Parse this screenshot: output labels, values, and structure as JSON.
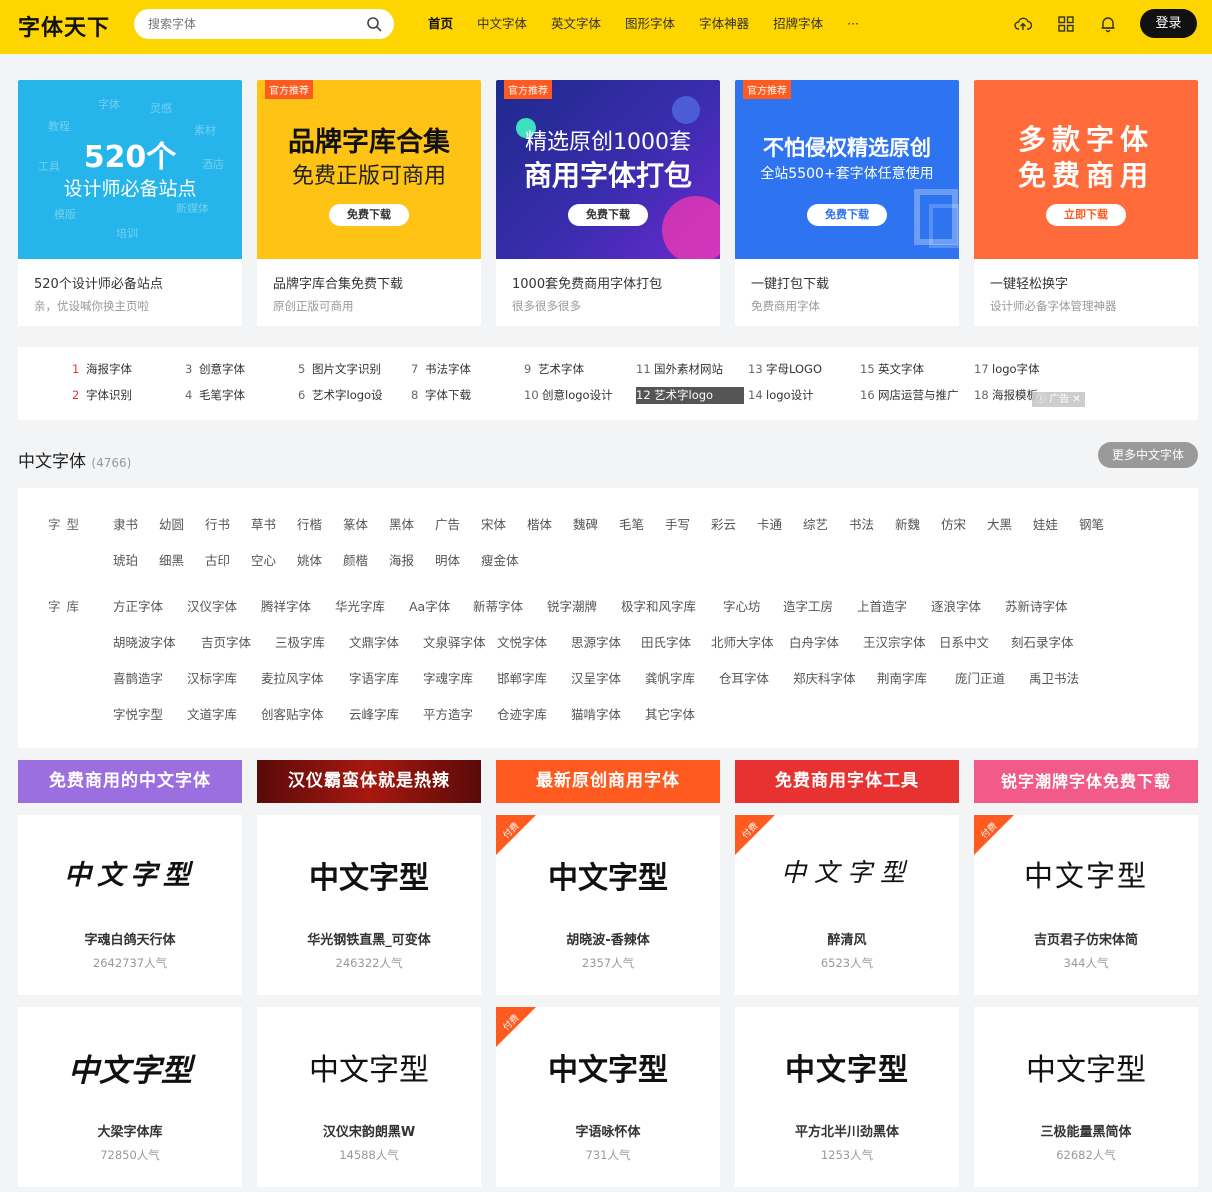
{
  "header": {
    "logo": "字体天下",
    "search_placeholder": "搜索字体",
    "nav": [
      "首页",
      "中文字体",
      "英文字体",
      "图形字体",
      "字体神器",
      "招牌字体",
      "···"
    ],
    "login": "登录"
  },
  "banners": [
    {
      "big": "520个",
      "sub": "设计师必备站点",
      "btn": "",
      "tag": "",
      "title": "520个设计师必备站点",
      "desc": "亲，优设喊你换主页啦",
      "bg": "#26b5ea"
    },
    {
      "big": "品牌字库合集",
      "sub": "免费正版可商用",
      "btn": "免费下载",
      "tag": "官方推荐",
      "title": "品牌字库合集免费下载",
      "desc": "原创正版可商用",
      "bg": "#ffc316"
    },
    {
      "big": "精选原创1000套",
      "sub": "商用字体打包",
      "btn": "免费下载",
      "tag": "官方推荐",
      "title": "1000套免费商用字体打包",
      "desc": "很多很多很多",
      "bg": "#3a2cae"
    },
    {
      "big": "不怕侵权精选原创",
      "sub": "全站5500+套字体任意使用",
      "btn": "免费下载",
      "tag": "官方推荐",
      "title": "一键打包下载",
      "desc": "免费商用字体",
      "bg": "#2e73f0"
    },
    {
      "big": "多款字体",
      "sub": "免费商用",
      "btn": "立即下载",
      "tag": "",
      "title": "一键轻松换字",
      "desc": "设计师必备字体管理神器",
      "bg": "#ff6b3a"
    }
  ],
  "banner1_words": [
    "字体",
    "灵感",
    "教程",
    "素材",
    "工具",
    "酒店",
    "模版",
    "新媒体",
    "培训"
  ],
  "hot": [
    {
      "n": "1",
      "t": "海报字体"
    },
    {
      "n": "2",
      "t": "字体识别"
    },
    {
      "n": "3",
      "t": "创意字体"
    },
    {
      "n": "4",
      "t": "毛笔字体"
    },
    {
      "n": "5",
      "t": "图片文字识别"
    },
    {
      "n": "6",
      "t": "艺术字logo设"
    },
    {
      "n": "7",
      "t": "书法字体"
    },
    {
      "n": "8",
      "t": "字体下载"
    },
    {
      "n": "9",
      "t": "艺术字体"
    },
    {
      "n": "10",
      "t": "创意logo设计"
    },
    {
      "n": "11",
      "t": "国外素材网站"
    },
    {
      "n": "12",
      "t": "艺术字logo"
    },
    {
      "n": "13",
      "t": "字母LOGO"
    },
    {
      "n": "14",
      "t": "logo设计"
    },
    {
      "n": "15",
      "t": "英文字体"
    },
    {
      "n": "16",
      "t": "网店运营与推广"
    },
    {
      "n": "17",
      "t": "logo字体"
    },
    {
      "n": "18",
      "t": "海报模板"
    }
  ],
  "ad_label": "广告",
  "section": {
    "title": "中文字体",
    "count": "(4766)",
    "more": "更多中文字体"
  },
  "filter": {
    "type_label": "字型",
    "types": [
      "隶书",
      "幼圆",
      "行书",
      "草书",
      "行楷",
      "篆体",
      "黑体",
      "广告",
      "宋体",
      "楷体",
      "魏碑",
      "毛笔",
      "手写",
      "彩云",
      "卡通",
      "综艺",
      "书法",
      "新魏",
      "仿宋",
      "大黑",
      "娃娃",
      "钢笔",
      "琥珀",
      "细黑",
      "古印",
      "空心",
      "姚体",
      "颜楷",
      "海报",
      "明体",
      "瘦金体"
    ],
    "lib_label": "字库",
    "libs": [
      "方正字体",
      "汉仪字体",
      "腾祥字体",
      "华光字库",
      "Aa字体",
      "新蒂字体",
      "锐字潮牌",
      "极字和风字库",
      "字心坊",
      "造字工房",
      "上首造字",
      "逐浪字体",
      "苏新诗字体",
      "胡晓波字体",
      "吉页字体",
      "三极字库",
      "文鼎字体",
      "文泉驿字体",
      "文悦字体",
      "思源字体",
      "田氏字体",
      "北师大字体",
      "白舟字体",
      "王汉宗字体",
      "日系中文",
      "刻石录字体",
      "喜鹊造字",
      "汉标字库",
      "麦拉风字体",
      "字语字库",
      "字魂字库",
      "邯郸字库",
      "汉呈字体",
      "龚帆字库",
      "仓耳字体",
      "郑庆科字体",
      "荆南字库",
      "庞门正道",
      "禹卫书法",
      "字悦字型",
      "文道字库",
      "创客贴字体",
      "云峰字库",
      "平方造字",
      "仓迹字库",
      "猫啃字体",
      "其它字体"
    ]
  },
  "categories": [
    {
      "t": "免费商用的中文字体",
      "bg": "#9b6fe0"
    },
    {
      "t": "汉仪霸蛮体就是热辣",
      "bg": "#8a1010"
    },
    {
      "t": "最新原创商用字体",
      "bg": "#ff5a1f"
    },
    {
      "t": "免费商用字体工具",
      "bg": "#e83232"
    },
    {
      "t": "锐字潮牌字体免费下载",
      "bg": "#f25a8a"
    }
  ],
  "paid_label": "付费",
  "cards": [
    {
      "sample": "中文字型",
      "name": "字魂白鸽天行体",
      "pop": "2642737人气",
      "paid": false
    },
    {
      "sample": "中文字型",
      "name": "华光钢铁直黑_可变体",
      "pop": "246322人气",
      "paid": false
    },
    {
      "sample": "中文字型",
      "name": "胡晓波-香辣体",
      "pop": "2357人气",
      "paid": true
    },
    {
      "sample": "中文字型",
      "name": "醉清风",
      "pop": "6523人气",
      "paid": true
    },
    {
      "sample": "中文字型",
      "name": "吉页君子仿宋体简",
      "pop": "344人气",
      "paid": true
    },
    {
      "sample": "中文字型",
      "name": "大梁字体库",
      "pop": "72850人气",
      "paid": false
    },
    {
      "sample": "中文字型",
      "name": "汉仪宋韵朗黑W",
      "pop": "14588人气",
      "paid": false
    },
    {
      "sample": "中文字型",
      "name": "字语咏怀体",
      "pop": "731人气",
      "paid": true
    },
    {
      "sample": "中文字型",
      "name": "平方北半川劲黑体",
      "pop": "1253人气",
      "paid": false
    },
    {
      "sample": "中文字型",
      "name": "三极能量黑简体",
      "pop": "62682人气",
      "paid": false
    }
  ]
}
